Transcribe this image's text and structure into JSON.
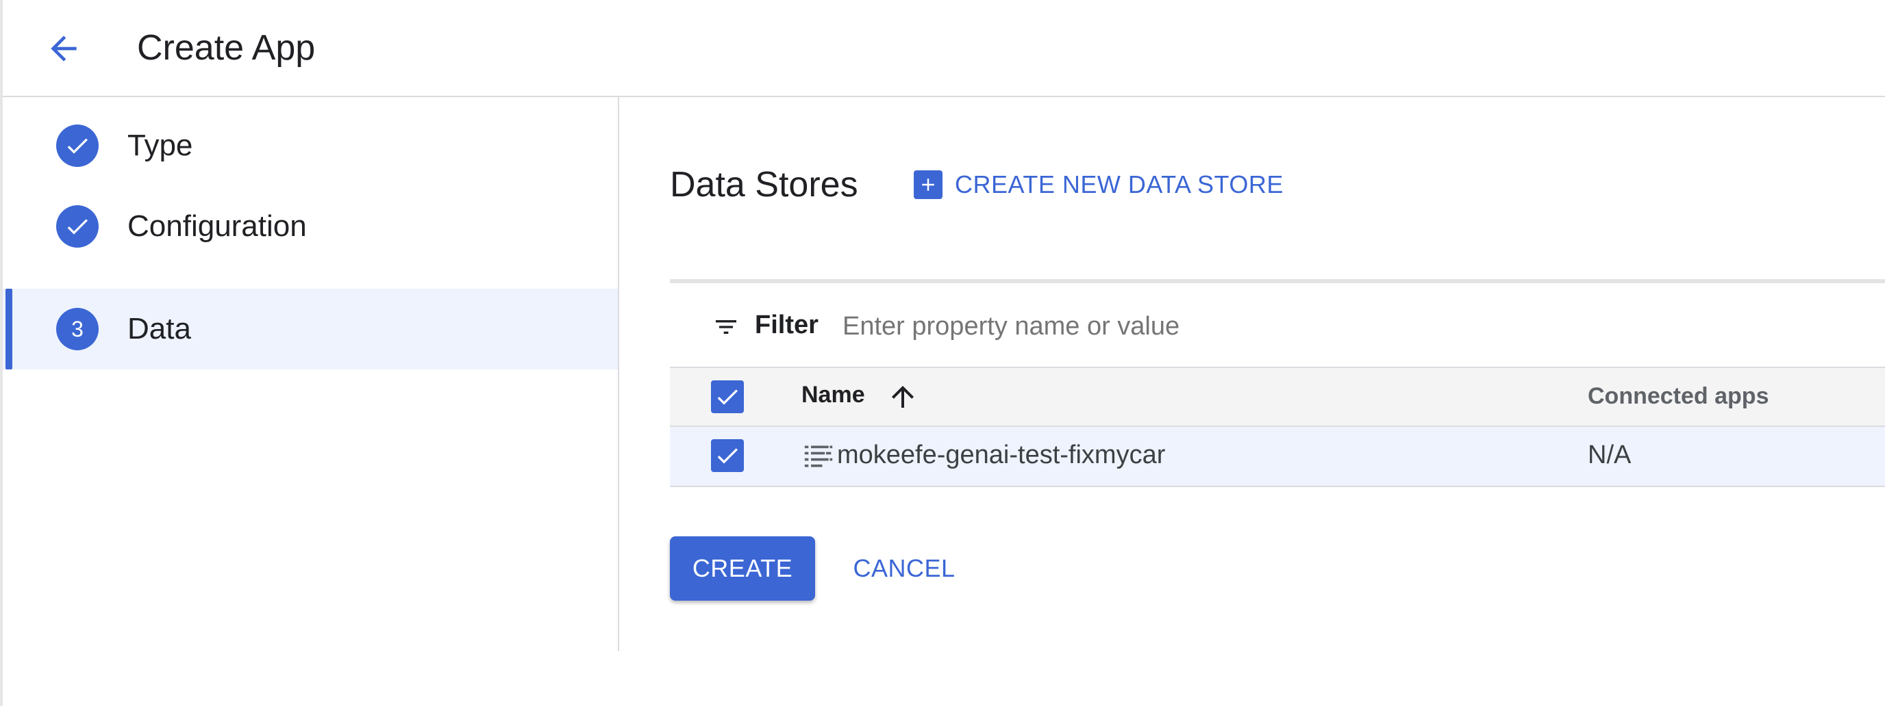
{
  "header": {
    "title": "Create App"
  },
  "stepper": {
    "steps": [
      {
        "label": "Type",
        "status": "complete"
      },
      {
        "label": "Configuration",
        "status": "complete"
      },
      {
        "label": "Data",
        "status": "active",
        "number": "3"
      }
    ]
  },
  "main": {
    "section_title": "Data Stores",
    "create_store_label": "CREATE NEW DATA STORE",
    "filter": {
      "label": "Filter",
      "placeholder": "Enter property name or value"
    },
    "table": {
      "columns": [
        "Name",
        "Connected apps"
      ],
      "rows": [
        {
          "name": "mokeefe-genai-test-fixmycar",
          "connected_apps": "N/A",
          "selected": true
        }
      ]
    },
    "buttons": {
      "create": "CREATE",
      "cancel": "CANCEL"
    }
  },
  "colors": {
    "accent": "#3b66d4",
    "active_step_bg": "#eef3fd",
    "table_header_bg": "#f4f4f4"
  },
  "icons": {
    "back": "arrow-left-icon",
    "check": "check-icon",
    "plus": "plus-icon",
    "filter": "filter-icon",
    "sort": "arrow-up-icon",
    "data_store": "data-store-icon"
  }
}
